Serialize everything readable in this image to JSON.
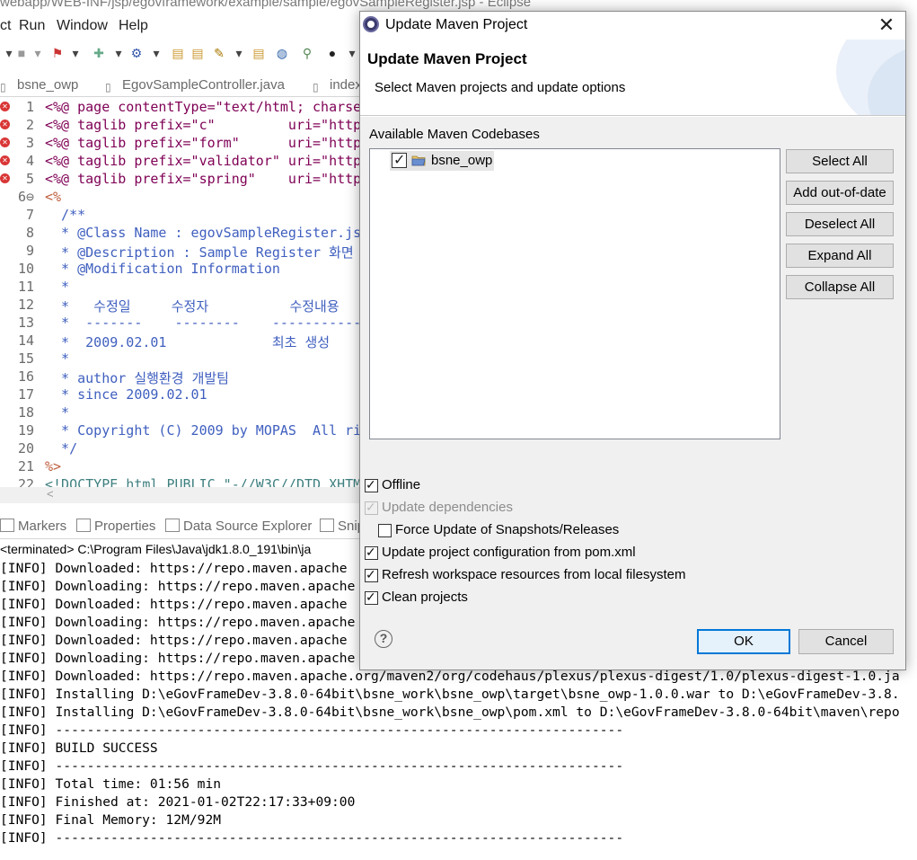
{
  "eclipse": {
    "title": "webapp/WEB-INF/jsp/egovframework/example/sample/egovSampleRegister.jsp - Eclipse",
    "menu": [
      "ct",
      "Run",
      "Window",
      "Help"
    ],
    "editor_tabs": [
      "bsne_owp",
      "EgovSampleController.java",
      "index"
    ],
    "editor_lines": [
      {
        "n": "1",
        "text": "<%@ page contentType=\"text/html; charse",
        "err": true
      },
      {
        "n": "2",
        "text": "<%@ taglib prefix=\"c\"         uri=\"http",
        "err": true
      },
      {
        "n": "3",
        "text": "<%@ taglib prefix=\"form\"      uri=\"http",
        "err": true
      },
      {
        "n": "4",
        "text": "<%@ taglib prefix=\"validator\" uri=\"http",
        "err": true
      },
      {
        "n": "5",
        "text": "<%@ taglib prefix=\"spring\"    uri=\"http",
        "err": true
      },
      {
        "n": "6⊖",
        "text": "<%",
        "err": false
      },
      {
        "n": "7",
        "text": "  /**",
        "err": false
      },
      {
        "n": "8",
        "text": "  * @Class Name : egovSampleRegister.js",
        "err": false
      },
      {
        "n": "9",
        "text": "  * @Description : Sample Register 화면",
        "err": false
      },
      {
        "n": "10",
        "text": "  * @Modification Information",
        "err": false
      },
      {
        "n": "11",
        "text": "  *",
        "err": false
      },
      {
        "n": "12",
        "text": "  *   수정일     수정자          수정내용",
        "err": false
      },
      {
        "n": "13",
        "text": "  *  -------    --------    -----------",
        "err": false
      },
      {
        "n": "14",
        "text": "  *  2009.02.01             최초 생성",
        "err": false
      },
      {
        "n": "15",
        "text": "  *",
        "err": false
      },
      {
        "n": "16",
        "text": "  * author 실행환경 개발팀",
        "err": false
      },
      {
        "n": "17",
        "text": "  * since 2009.02.01",
        "err": false
      },
      {
        "n": "18",
        "text": "  *",
        "err": false
      },
      {
        "n": "19",
        "text": "  * Copyright (C) 2009 by MOPAS  All ri",
        "err": false
      },
      {
        "n": "20",
        "text": "  */",
        "err": false
      },
      {
        "n": "21",
        "text": "%>",
        "err": false
      },
      {
        "n": "22",
        "text": "<!DOCTYPE html PUBLIC \"-//W3C//DTD XHTM",
        "err": false
      }
    ],
    "view_tabs": [
      "Markers",
      "Properties",
      "Data Source Explorer",
      "Snip"
    ],
    "console_header": "<terminated> C:\\Program Files\\Java\\jdk1.8.0_191\\bin\\ja",
    "console_lines": [
      "[INFO] Downloaded: https://repo.maven.apache",
      "[INFO] Downloading: https://repo.maven.apache",
      "[INFO] Downloaded: https://repo.maven.apache",
      "[INFO] Downloading: https://repo.maven.apache",
      "[INFO] Downloaded: https://repo.maven.apache",
      "[INFO] Downloading: https://repo.maven.apache",
      "[INFO] Downloaded: https://repo.maven.apache.org/maven2/org/codehaus/plexus/plexus-digest/1.0/plexus-digest-1.0.ja",
      "[INFO] Installing D:\\eGovFrameDev-3.8.0-64bit\\bsne_work\\bsne_owp\\target\\bsne_owp-1.0.0.war to D:\\eGovFrameDev-3.8.",
      "[INFO] Installing D:\\eGovFrameDev-3.8.0-64bit\\bsne_work\\bsne_owp\\pom.xml to D:\\eGovFrameDev-3.8.0-64bit\\maven\\repo",
      "[INFO] ------------------------------------------------------------------------",
      "[INFO] BUILD SUCCESS",
      "[INFO] ------------------------------------------------------------------------",
      "[INFO] Total time: 01:56 min",
      "[INFO] Finished at: 2021-01-02T22:17:33+09:00",
      "[INFO] Final Memory: 12M/92M",
      "[INFO] ------------------------------------------------------------------------"
    ]
  },
  "dialog": {
    "window_title": "Update Maven Project",
    "heading": "Update Maven Project",
    "subtitle": "Select Maven projects and update options",
    "codebases_label": "Available Maven Codebases",
    "project": {
      "name": "bsne_owp",
      "checked": true
    },
    "buttons": {
      "select_all": "Select All",
      "add_out_of_date": "Add out-of-date",
      "deselect_all": "Deselect All",
      "expand_all": "Expand All",
      "collapse_all": "Collapse All"
    },
    "options": {
      "offline": {
        "label": "Offline",
        "checked": true
      },
      "update_dependencies": {
        "label": "Update dependencies",
        "checked": true,
        "disabled": true
      },
      "force_update": {
        "label": "Force Update of Snapshots/Releases",
        "checked": false
      },
      "update_config": {
        "label": "Update project configuration from pom.xml",
        "checked": true
      },
      "refresh_workspace": {
        "label": "Refresh workspace resources from local filesystem",
        "checked": true
      },
      "clean_projects": {
        "label": "Clean projects",
        "checked": true
      }
    },
    "ok_label": "OK",
    "cancel_label": "Cancel",
    "help_symbol": "?",
    "close_symbol": "✕"
  },
  "colors": {
    "accent": "#0078d7",
    "error": "#d93636",
    "selection": "#3399ff"
  }
}
